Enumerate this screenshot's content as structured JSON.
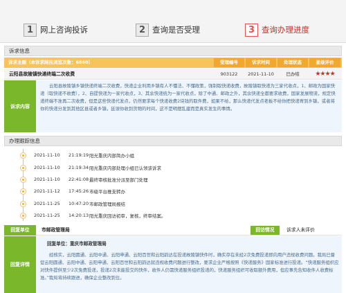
{
  "steps": [
    {
      "num": "1",
      "label": "网上咨询投诉"
    },
    {
      "num": "2",
      "label": "查询是否受理"
    },
    {
      "num": "3",
      "label": "查询办理进度"
    }
  ],
  "petition": {
    "section_title": "诉求信息",
    "subject_label": "诉求主题（本诉求网民浏览次数：6860）",
    "columns": [
      "受理编号",
      "诉求时间",
      "处理状态",
      "星级评价"
    ],
    "title": "云阳县故陵镇快递终端二次收费",
    "id": "903122",
    "date": "2021-11-10",
    "status": "已办结",
    "rating": 4,
    "rating_display": "★★★★",
    "content_label": "诉求内容",
    "content": "云阳县故陵镇乡镇快递终端二次收费，快递企业利用乡镇有人不懂法、不懂政策，强制取快递收费，故陵镇取快递为三家代收点，1、邮政为国家快递（取快递不收费），2、自提快递为一家代收点，3、其余快递统为一家代收点，除了中通、邮政之外，其余快递全都要求收费，国家发展物流，规定快递终端不准再二次收费，但是这些快递代发点，仍然要求每个快递收费2块钱的取件费，如果不给，那么快递代发点老板不给你把快递寄到乡镇，或者将你的快递分发到其他区县或者乡镇，延误你收到货物的时间，这不是明摆乱建而是真实发生的事情。"
  },
  "progress": {
    "section_title": "办理跟踪信息",
    "events": [
      {
        "date": "2021-11-10",
        "time": "21:19:19",
        "event": "阳光重庆内部简办小组"
      },
      {
        "date": "2021-11-10",
        "time": "21:19:34",
        "event": "阳光重庆内部处理小组已认领该诉求"
      },
      {
        "date": "2021-11-10",
        "time": "22:41:08",
        "event": "最终审核批准分派至部门处理"
      },
      {
        "date": "2021-11-12",
        "time": "17:45:26",
        "event": "市级平台推支转办"
      },
      {
        "date": "2021-11-25",
        "time": "10:47:20",
        "event": "市邮政管理局报结"
      },
      {
        "date": "2021-11-25",
        "time": "14:20:13",
        "event": "阳光重庆回访初审，复核，终审结案。"
      }
    ]
  },
  "reply": {
    "unit_label": "回复单位",
    "unit": "市邮政管理局",
    "eval_label": "回访情况",
    "eval_value": "诉求人未评价",
    "detail_label": "回复详情",
    "unit_line": "回复单位：重庆市邮政管理局",
    "text": "经核实，云阳圆通、云阳中通、云阳申通、云阳百世和云阳韵达在投递故陵镇快件时，确实存在未经2次免费投递即向用户违规收费问题。我局已督促云阳圆通、云阳中通、云阳申通、云阳百世和云阳韵达就违规收费问题进行整改，要求企业严格按照《快递服务》国家标准进行投递。“快递服务组织应对快件提供至少2次免费投递，投递2次未能投交的快件，收件人仍需快递服务组织投递的，快递服务组织可收取额外费用，但应事先告知收件人收费标准。”我局将持续跟进，确保企业整改到位。"
  },
  "colors": {
    "accent_orange": "#f7c35a",
    "accent_green": "#7bb72a",
    "active_red": "#c9302c",
    "text_blue": "#4a6b8c",
    "star_red": "#c9302c"
  }
}
